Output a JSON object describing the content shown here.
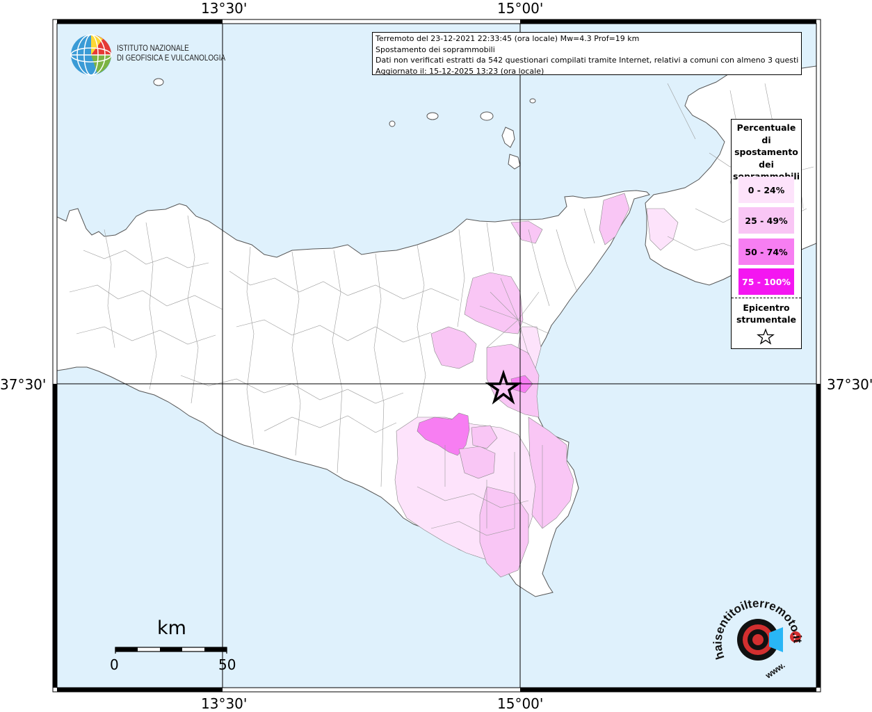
{
  "map": {
    "grid_lon_labels": [
      "13°30'",
      "15°00'"
    ],
    "grid_lat_labels": [
      "37°30'"
    ],
    "colors": {
      "sea": "#dff1fc",
      "land": "#ffffff",
      "border": "#7a7a7a",
      "class_0_24": "#fde3fb",
      "class_25_49": "#f9c6f5",
      "class_50_74": "#f77ef2",
      "class_75_100": "#f416f1"
    }
  },
  "info": {
    "line1": "Terremoto del 23-12-2021 22:33:45 (ora locale) Mw=4.3 Prof=19 km",
    "line2": "Spostamento dei soprammobili",
    "line3": "Dati non verificati estratti da 542 questionari compilati tramite Internet, relativi a comuni con almeno 3 questionari.",
    "line4": "Aggiornato il: 15-12-2025 13:23 (ora locale)"
  },
  "institute": {
    "line1": "ISTITUTO NAZIONALE",
    "line2": "DI GEOFISICA E VULCANOLOGIA"
  },
  "legend": {
    "title": [
      "Percentuale",
      "di",
      "spostamento",
      "dei",
      "soprammobili"
    ],
    "classes": [
      {
        "label": "0 - 24%",
        "color": "#fde3fb"
      },
      {
        "label": "25 - 49%",
        "color": "#f9c6f5"
      },
      {
        "label": "50 - 74%",
        "color": "#f77ef2"
      },
      {
        "label": "75 - 100%",
        "color": "#f416f1"
      }
    ],
    "epicenter": [
      "Epicentro",
      "strumentale"
    ]
  },
  "scale": {
    "unit": "km",
    "min_label": "0",
    "max_label": "50"
  },
  "badge": {
    "site": "haisentitoilterremoto.it",
    "prefix": "www."
  }
}
